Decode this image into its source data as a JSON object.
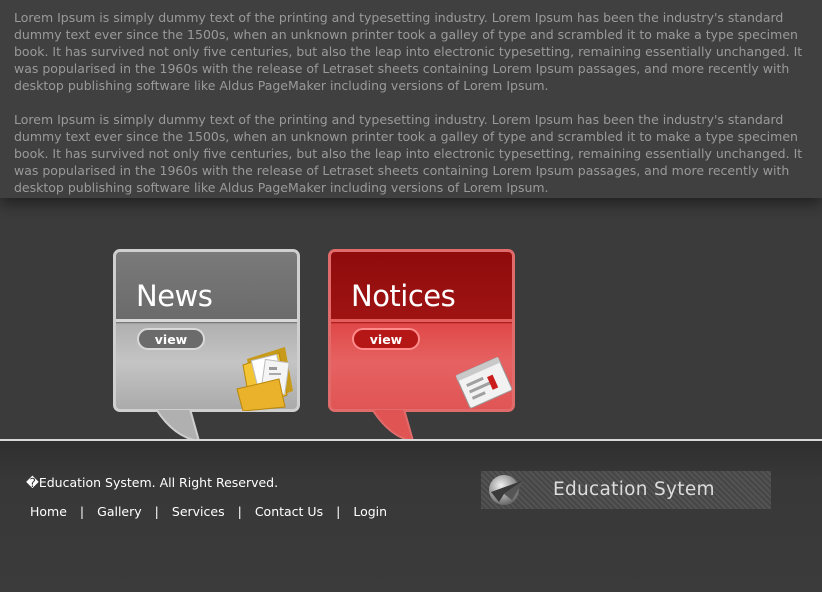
{
  "main": {
    "paragraphs": [
      "Lorem Ipsum is simply dummy text of the printing and typesetting industry. Lorem Ipsum has been the industry's standard dummy text ever since the 1500s, when an unknown printer took a galley of type and scrambled it to make a type specimen book. It has survived not only five centuries, but also the leap into electronic typesetting, remaining essentially unchanged. It was popularised in the 1960s with the release of Letraset sheets containing Lorem Ipsum passages, and more recently with desktop publishing software like Aldus PageMaker including versions of Lorem Ipsum.",
      "Lorem Ipsum is simply dummy text of the printing and typesetting industry. Lorem Ipsum has been the industry's standard dummy text ever since the 1500s, when an unknown printer took a galley of type and scrambled it to make a type specimen book. It has survived not only five centuries, but also the leap into electronic typesetting, remaining essentially unchanged. It was popularised in the 1960s with the release of Letraset sheets containing Lorem Ipsum passages, and more recently with desktop publishing software like Aldus PageMaker including versions of Lorem Ipsum."
    ]
  },
  "cards": [
    {
      "title": "News",
      "button": "view",
      "icon": "folder-documents-icon",
      "color": "#a9a9a9"
    },
    {
      "title": "Notices",
      "button": "view",
      "icon": "document-window-icon",
      "color": "#e05454"
    }
  ],
  "footer": {
    "copyright": "�Education System. All Right Reserved.",
    "nav": [
      "Home",
      "Gallery",
      "Services",
      "Contact Us",
      "Login"
    ],
    "separator": "|",
    "logo_text": "Education Sytem",
    "logo_icon": "paper-plane-emblem-icon"
  },
  "colors": {
    "background": "#3b3b3b",
    "body_text": "#9a9a9a",
    "notices_accent": "#a01313"
  }
}
